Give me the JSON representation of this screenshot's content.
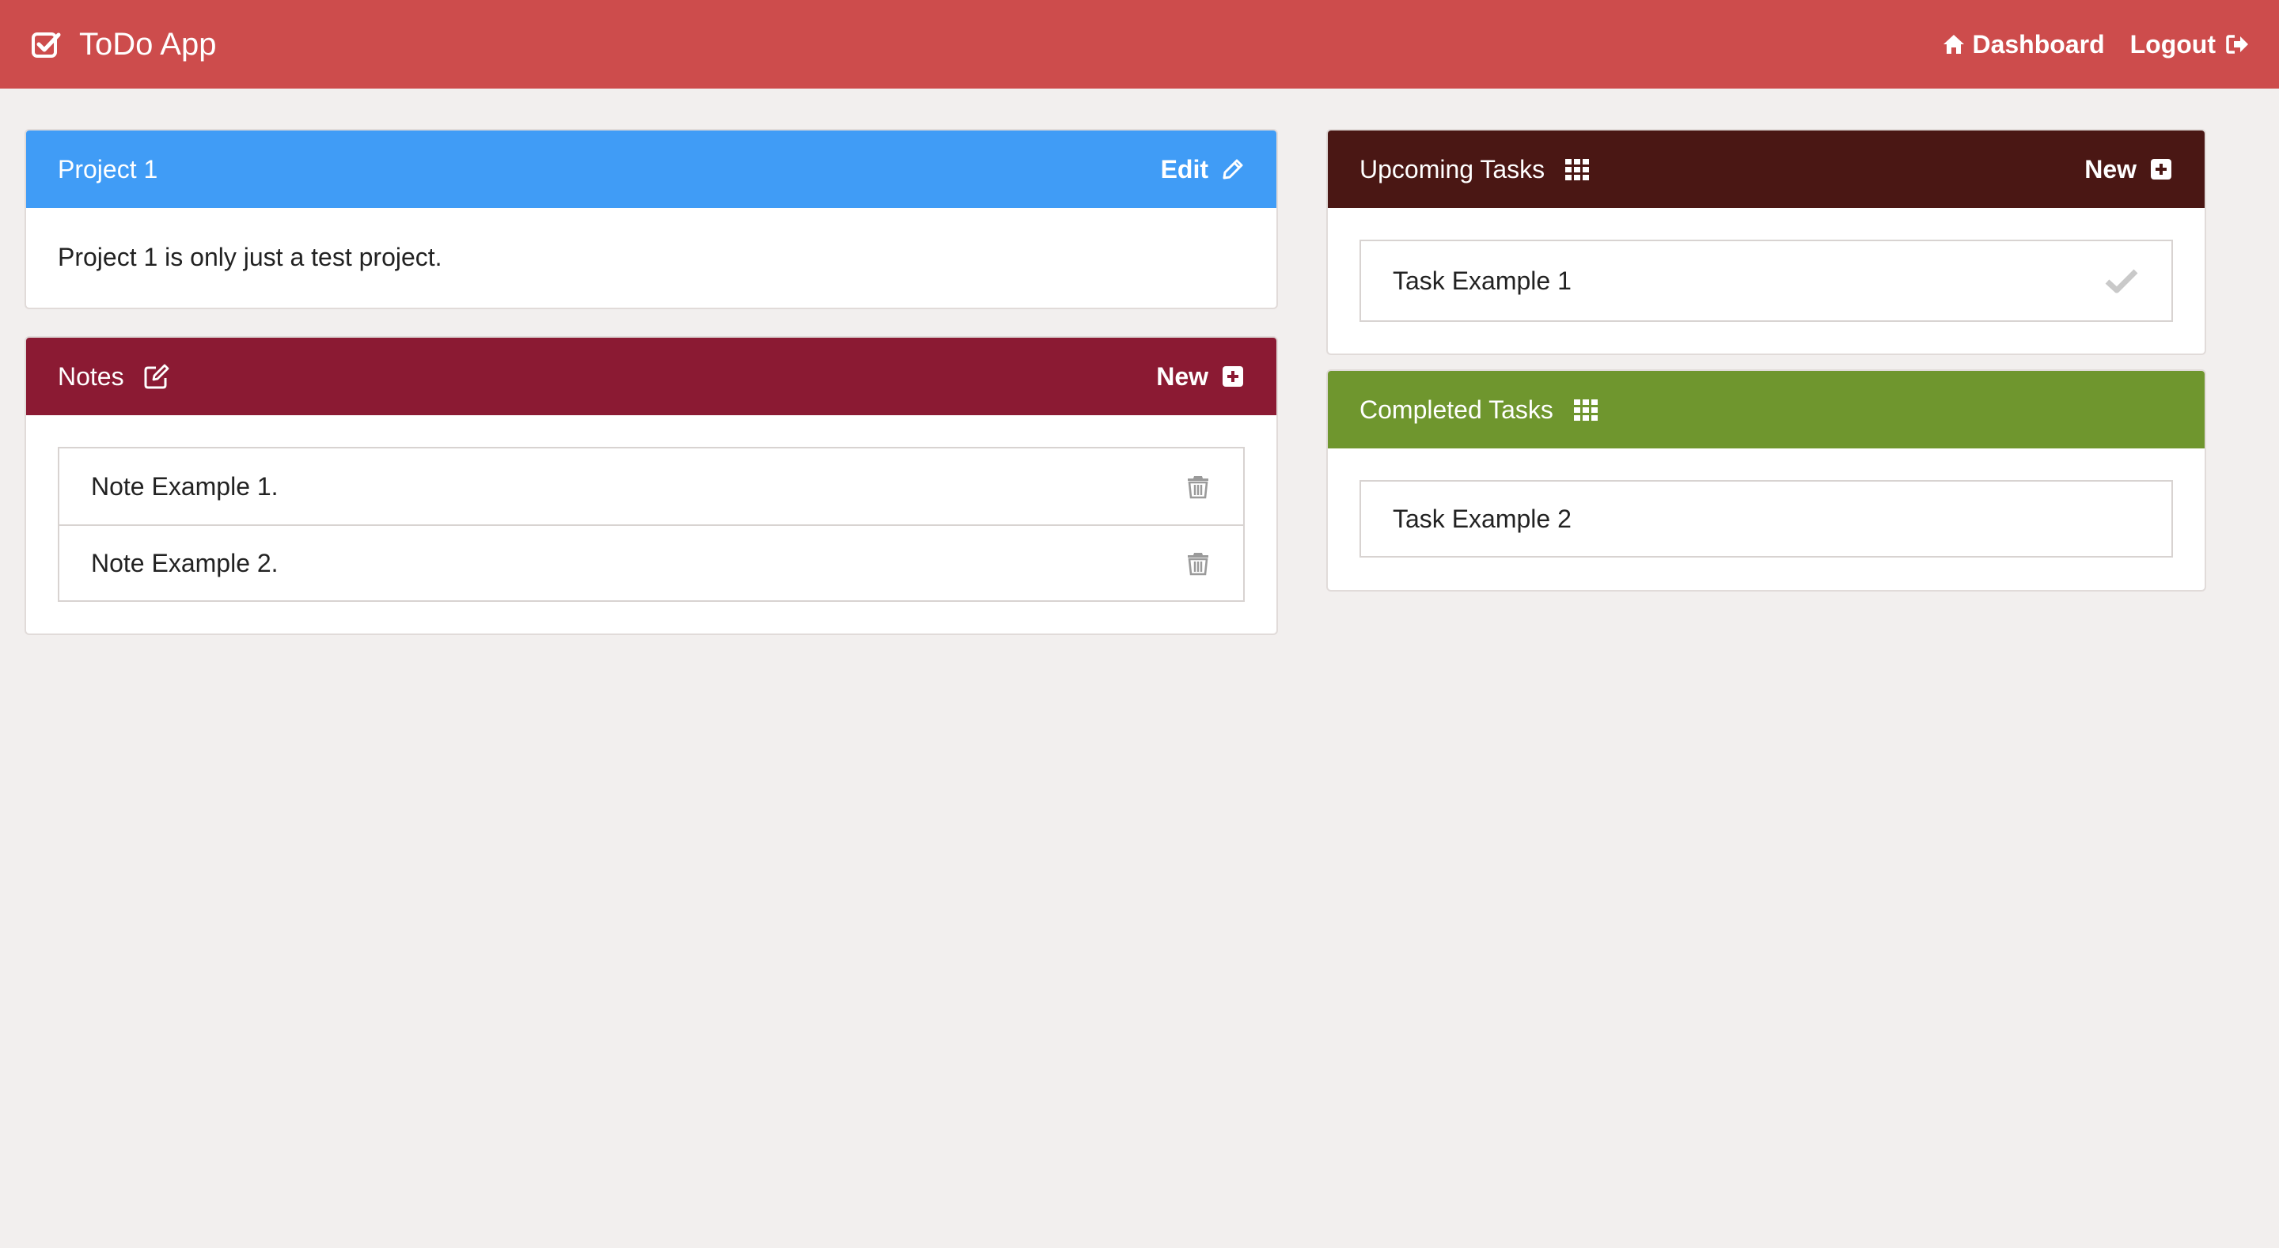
{
  "navbar": {
    "brand_icon": "check-square-icon",
    "title": "ToDo App",
    "dashboard_label": "Dashboard",
    "dashboard_icon": "home-icon",
    "logout_label": "Logout",
    "logout_icon": "sign-out-icon"
  },
  "project": {
    "title": "Project 1",
    "edit_label": "Edit",
    "edit_icon": "pencil-icon",
    "description": "Project 1 is only just a test project.",
    "header_color": "#409cf6"
  },
  "notes": {
    "title": "Notes",
    "title_icon": "edit-note-icon",
    "new_label": "New",
    "new_icon": "plus-square-icon",
    "header_color": "#8b1a33",
    "items": [
      {
        "text": "Note Example 1.",
        "action_icon": "trash-icon"
      },
      {
        "text": "Note Example 2.",
        "action_icon": "trash-icon"
      }
    ]
  },
  "upcoming": {
    "title": "Upcoming Tasks",
    "title_icon": "grid-icon",
    "new_label": "New",
    "new_icon": "plus-square-icon",
    "header_color": "#4a1714",
    "items": [
      {
        "text": "Task Example 1",
        "action_icon": "check-icon"
      }
    ]
  },
  "completed": {
    "title": "Completed Tasks",
    "title_icon": "grid-icon",
    "header_color": "#6f962e",
    "items": [
      {
        "text": "Task Example 2"
      }
    ]
  }
}
